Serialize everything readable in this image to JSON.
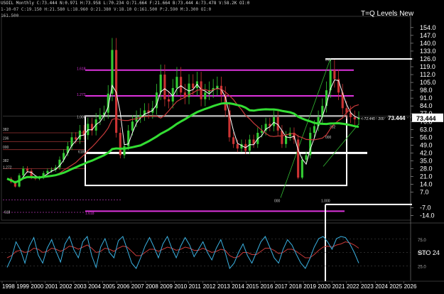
{
  "header": {
    "line1": "USOIL Monthly  C:73.444  N:0.971  H:73.958  L:70.234  O:71.664  F:21.664  B:73.444  A:73.478  V:58.2K  OI:0",
    "line2": "1-10-07  C:19.150  H:21.580  L:18.960  O:21.380  V:18.10  O:161.500  P:2.590  M:3.300  OI:0",
    "line3": "161.500"
  },
  "chart_title": "T=Q Levels New",
  "last_price_label": "73.444",
  "price_annotation": "<-72.440 - 200",
  "indicator_label": "STO  24",
  "fib_labels": [
    "1.618",
    "1.272",
    "1.000",
    "618",
    "382",
    "236",
    "000",
    "1.272",
    "1.618",
    "618",
    "382",
    "000",
    "618",
    "382",
    "000",
    "1.000"
  ],
  "chart_data": [
    {
      "type": "candlestick",
      "title": "T=Q Levels New",
      "x": [
        "1998",
        "1999",
        "2000",
        "2001",
        "2002",
        "2003",
        "2004",
        "2005",
        "2006",
        "2007",
        "2008",
        "2009",
        "2010",
        "2011",
        "2012",
        "2013",
        "2014",
        "2015",
        "2016",
        "2017",
        "2018",
        "2019",
        "2020",
        "2021",
        "2022",
        "2023",
        "2024",
        "2025",
        "2026"
      ],
      "y_axis_ticks": [
        154.0,
        147.0,
        140.0,
        133.0,
        126.0,
        119.0,
        112.0,
        105.0,
        98.0,
        91.0,
        84.0,
        77.0,
        70.0,
        63.0,
        56.0,
        49.0,
        42.0,
        35.0,
        28.0,
        21.0,
        14.0,
        7.0,
        -7.0,
        -14.0
      ],
      "ylim": [
        -18,
        161.5
      ],
      "last_value": 73.444,
      "series": [
        {
          "name": "",
          "color": "#ffffff",
          "values": [
            19,
            16,
            12,
            22,
            28,
            26,
            20,
            19,
            20,
            24,
            26,
            27,
            29,
            36,
            42,
            48,
            56,
            54,
            62,
            58,
            68,
            62,
            72,
            76,
            78,
            95,
            134,
            60,
            40,
            48,
            62,
            70,
            74,
            76,
            80,
            78,
            82,
            96,
            112,
            90,
            88,
            100,
            110,
            96,
            92,
            104,
            100,
            106,
            90,
            96,
            98,
            100,
            102,
            94,
            80,
            56,
            50,
            46,
            50,
            44,
            54,
            50,
            60,
            62,
            68,
            66,
            74,
            62,
            50,
            57,
            60,
            54,
            20,
            36,
            40,
            60,
            66,
            74,
            84,
            98,
            116,
            108,
            96,
            82,
            78,
            74,
            72,
            73.4
          ]
        },
        {
          "name": "",
          "color": "#c83a3a",
          "values": []
        },
        {
          "name": "",
          "color": "#33dd33",
          "values": []
        }
      ],
      "levels": [
        {
          "label": "1.618",
          "value": 116.0,
          "color": "#dd33dd"
        },
        {
          "label": "1.272",
          "value": 93.0,
          "color": "#dd33dd"
        },
        {
          "label": "1.000",
          "value": 75.0,
          "color": "#ffffff"
        },
        {
          "label": "000",
          "value": 126.0,
          "color": "#ffffff"
        },
        {
          "label": "",
          "value": 42.0,
          "color": "#ffffff"
        },
        {
          "label": "",
          "value": 13.0,
          "color": "#ffffff"
        },
        {
          "label": "",
          "value": -4.0,
          "color": "#ffffff"
        },
        {
          "label": "1.272",
          "value": -10.0,
          "color": "#dd33dd"
        }
      ]
    },
    {
      "type": "line",
      "title": "STO 24",
      "x": [
        "1998",
        "2026"
      ],
      "y_axis_ticks": [
        25.0,
        50.0,
        75.0
      ],
      "ylim": [
        0,
        100
      ],
      "series": [
        {
          "name": "",
          "color": "#3ab0e0",
          "values": [
            22,
            40,
            70,
            55,
            30,
            62,
            78,
            45,
            30,
            58,
            74,
            52,
            32,
            66,
            80,
            55,
            40,
            70,
            80,
            44,
            22,
            60,
            76,
            50,
            40,
            72,
            80,
            55,
            30,
            20,
            40,
            62,
            78,
            60,
            40,
            66,
            80,
            58,
            40,
            62,
            78,
            64,
            42,
            56,
            70,
            50,
            36,
            58,
            74,
            50,
            20,
            30,
            50,
            66,
            44,
            30,
            50,
            70,
            80,
            60,
            40,
            30,
            56,
            74,
            64,
            46,
            30,
            20,
            38,
            60,
            76,
            80,
            70,
            56,
            76,
            80,
            78,
            66,
            50,
            30
          ]
        },
        {
          "name": "",
          "color": "#c83a3a",
          "values": [
            40,
            44,
            52,
            54,
            50,
            52,
            58,
            56,
            50,
            52,
            58,
            56,
            52,
            56,
            62,
            60,
            56,
            60,
            64,
            58,
            50,
            52,
            58,
            56,
            52,
            58,
            62,
            60,
            52,
            44,
            44,
            50,
            56,
            56,
            52,
            56,
            60,
            58,
            54,
            56,
            60,
            58,
            54,
            54,
            58,
            54,
            50,
            52,
            56,
            54,
            44,
            40,
            42,
            50,
            50,
            46,
            46,
            52,
            58,
            58,
            54,
            48,
            50,
            56,
            56,
            52,
            46,
            40,
            40,
            46,
            54,
            60,
            62,
            60,
            64,
            66,
            70,
            68,
            64,
            58
          ]
        }
      ]
    }
  ]
}
